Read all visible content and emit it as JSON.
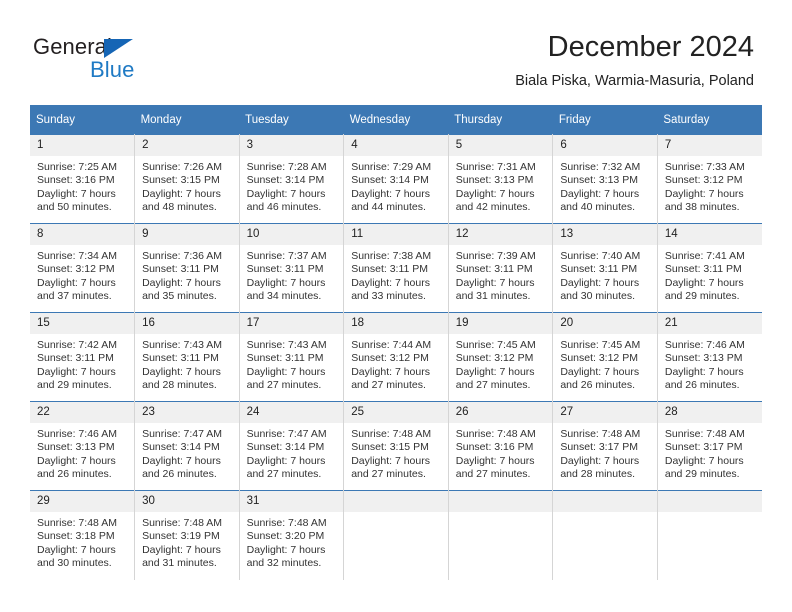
{
  "logo": {
    "word_top": "General",
    "word_bottom": "Blue",
    "triangle_color": "#1565b5",
    "blue_color": "#1f7ac4"
  },
  "header": {
    "title": "December 2024",
    "subtitle": "Biala Piska, Warmia-Masuria, Poland"
  },
  "colors": {
    "header_band": "#3c78b4",
    "daynum_band": "#f0f0f0",
    "cell_divider": "#d5d5d5"
  },
  "weekdays": [
    "Sunday",
    "Monday",
    "Tuesday",
    "Wednesday",
    "Thursday",
    "Friday",
    "Saturday"
  ],
  "weeks": [
    [
      {
        "day": "1",
        "sunrise": "Sunrise: 7:25 AM",
        "sunset": "Sunset: 3:16 PM",
        "daylight1": "Daylight: 7 hours",
        "daylight2": "and 50 minutes."
      },
      {
        "day": "2",
        "sunrise": "Sunrise: 7:26 AM",
        "sunset": "Sunset: 3:15 PM",
        "daylight1": "Daylight: 7 hours",
        "daylight2": "and 48 minutes."
      },
      {
        "day": "3",
        "sunrise": "Sunrise: 7:28 AM",
        "sunset": "Sunset: 3:14 PM",
        "daylight1": "Daylight: 7 hours",
        "daylight2": "and 46 minutes."
      },
      {
        "day": "4",
        "sunrise": "Sunrise: 7:29 AM",
        "sunset": "Sunset: 3:14 PM",
        "daylight1": "Daylight: 7 hours",
        "daylight2": "and 44 minutes."
      },
      {
        "day": "5",
        "sunrise": "Sunrise: 7:31 AM",
        "sunset": "Sunset: 3:13 PM",
        "daylight1": "Daylight: 7 hours",
        "daylight2": "and 42 minutes."
      },
      {
        "day": "6",
        "sunrise": "Sunrise: 7:32 AM",
        "sunset": "Sunset: 3:13 PM",
        "daylight1": "Daylight: 7 hours",
        "daylight2": "and 40 minutes."
      },
      {
        "day": "7",
        "sunrise": "Sunrise: 7:33 AM",
        "sunset": "Sunset: 3:12 PM",
        "daylight1": "Daylight: 7 hours",
        "daylight2": "and 38 minutes."
      }
    ],
    [
      {
        "day": "8",
        "sunrise": "Sunrise: 7:34 AM",
        "sunset": "Sunset: 3:12 PM",
        "daylight1": "Daylight: 7 hours",
        "daylight2": "and 37 minutes."
      },
      {
        "day": "9",
        "sunrise": "Sunrise: 7:36 AM",
        "sunset": "Sunset: 3:11 PM",
        "daylight1": "Daylight: 7 hours",
        "daylight2": "and 35 minutes."
      },
      {
        "day": "10",
        "sunrise": "Sunrise: 7:37 AM",
        "sunset": "Sunset: 3:11 PM",
        "daylight1": "Daylight: 7 hours",
        "daylight2": "and 34 minutes."
      },
      {
        "day": "11",
        "sunrise": "Sunrise: 7:38 AM",
        "sunset": "Sunset: 3:11 PM",
        "daylight1": "Daylight: 7 hours",
        "daylight2": "and 33 minutes."
      },
      {
        "day": "12",
        "sunrise": "Sunrise: 7:39 AM",
        "sunset": "Sunset: 3:11 PM",
        "daylight1": "Daylight: 7 hours",
        "daylight2": "and 31 minutes."
      },
      {
        "day": "13",
        "sunrise": "Sunrise: 7:40 AM",
        "sunset": "Sunset: 3:11 PM",
        "daylight1": "Daylight: 7 hours",
        "daylight2": "and 30 minutes."
      },
      {
        "day": "14",
        "sunrise": "Sunrise: 7:41 AM",
        "sunset": "Sunset: 3:11 PM",
        "daylight1": "Daylight: 7 hours",
        "daylight2": "and 29 minutes."
      }
    ],
    [
      {
        "day": "15",
        "sunrise": "Sunrise: 7:42 AM",
        "sunset": "Sunset: 3:11 PM",
        "daylight1": "Daylight: 7 hours",
        "daylight2": "and 29 minutes."
      },
      {
        "day": "16",
        "sunrise": "Sunrise: 7:43 AM",
        "sunset": "Sunset: 3:11 PM",
        "daylight1": "Daylight: 7 hours",
        "daylight2": "and 28 minutes."
      },
      {
        "day": "17",
        "sunrise": "Sunrise: 7:43 AM",
        "sunset": "Sunset: 3:11 PM",
        "daylight1": "Daylight: 7 hours",
        "daylight2": "and 27 minutes."
      },
      {
        "day": "18",
        "sunrise": "Sunrise: 7:44 AM",
        "sunset": "Sunset: 3:12 PM",
        "daylight1": "Daylight: 7 hours",
        "daylight2": "and 27 minutes."
      },
      {
        "day": "19",
        "sunrise": "Sunrise: 7:45 AM",
        "sunset": "Sunset: 3:12 PM",
        "daylight1": "Daylight: 7 hours",
        "daylight2": "and 27 minutes."
      },
      {
        "day": "20",
        "sunrise": "Sunrise: 7:45 AM",
        "sunset": "Sunset: 3:12 PM",
        "daylight1": "Daylight: 7 hours",
        "daylight2": "and 26 minutes."
      },
      {
        "day": "21",
        "sunrise": "Sunrise: 7:46 AM",
        "sunset": "Sunset: 3:13 PM",
        "daylight1": "Daylight: 7 hours",
        "daylight2": "and 26 minutes."
      }
    ],
    [
      {
        "day": "22",
        "sunrise": "Sunrise: 7:46 AM",
        "sunset": "Sunset: 3:13 PM",
        "daylight1": "Daylight: 7 hours",
        "daylight2": "and 26 minutes."
      },
      {
        "day": "23",
        "sunrise": "Sunrise: 7:47 AM",
        "sunset": "Sunset: 3:14 PM",
        "daylight1": "Daylight: 7 hours",
        "daylight2": "and 26 minutes."
      },
      {
        "day": "24",
        "sunrise": "Sunrise: 7:47 AM",
        "sunset": "Sunset: 3:14 PM",
        "daylight1": "Daylight: 7 hours",
        "daylight2": "and 27 minutes."
      },
      {
        "day": "25",
        "sunrise": "Sunrise: 7:48 AM",
        "sunset": "Sunset: 3:15 PM",
        "daylight1": "Daylight: 7 hours",
        "daylight2": "and 27 minutes."
      },
      {
        "day": "26",
        "sunrise": "Sunrise: 7:48 AM",
        "sunset": "Sunset: 3:16 PM",
        "daylight1": "Daylight: 7 hours",
        "daylight2": "and 27 minutes."
      },
      {
        "day": "27",
        "sunrise": "Sunrise: 7:48 AM",
        "sunset": "Sunset: 3:17 PM",
        "daylight1": "Daylight: 7 hours",
        "daylight2": "and 28 minutes."
      },
      {
        "day": "28",
        "sunrise": "Sunrise: 7:48 AM",
        "sunset": "Sunset: 3:17 PM",
        "daylight1": "Daylight: 7 hours",
        "daylight2": "and 29 minutes."
      }
    ],
    [
      {
        "day": "29",
        "sunrise": "Sunrise: 7:48 AM",
        "sunset": "Sunset: 3:18 PM",
        "daylight1": "Daylight: 7 hours",
        "daylight2": "and 30 minutes."
      },
      {
        "day": "30",
        "sunrise": "Sunrise: 7:48 AM",
        "sunset": "Sunset: 3:19 PM",
        "daylight1": "Daylight: 7 hours",
        "daylight2": "and 31 minutes."
      },
      {
        "day": "31",
        "sunrise": "Sunrise: 7:48 AM",
        "sunset": "Sunset: 3:20 PM",
        "daylight1": "Daylight: 7 hours",
        "daylight2": "and 32 minutes."
      },
      {
        "day": "",
        "sunrise": "",
        "sunset": "",
        "daylight1": "",
        "daylight2": ""
      },
      {
        "day": "",
        "sunrise": "",
        "sunset": "",
        "daylight1": "",
        "daylight2": ""
      },
      {
        "day": "",
        "sunrise": "",
        "sunset": "",
        "daylight1": "",
        "daylight2": ""
      },
      {
        "day": "",
        "sunrise": "",
        "sunset": "",
        "daylight1": "",
        "daylight2": ""
      }
    ]
  ]
}
